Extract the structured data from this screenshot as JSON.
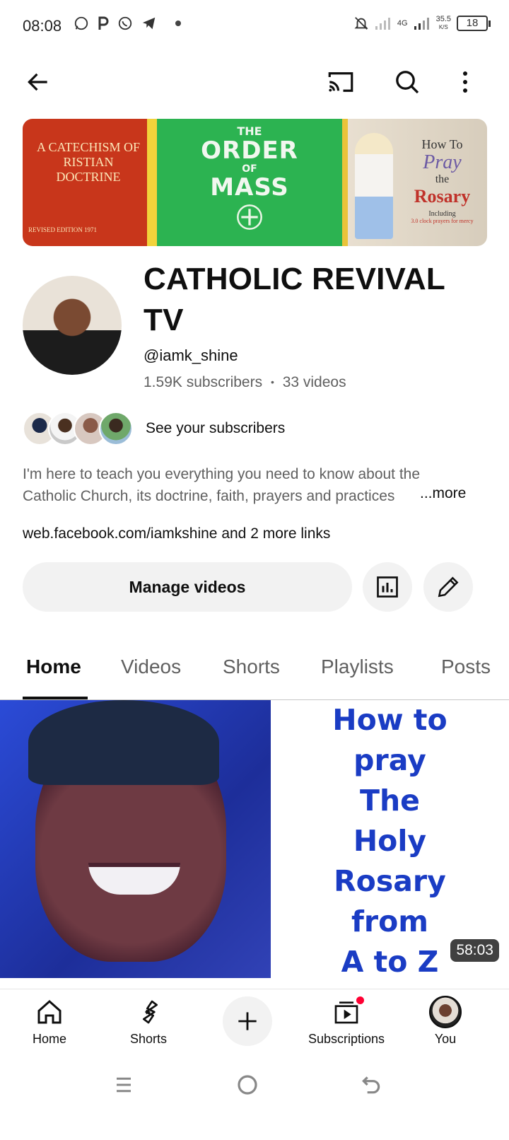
{
  "status_bar": {
    "time": "08:08",
    "network": "4G",
    "speed_value": "35.5",
    "speed_unit": "K/S",
    "battery": "18"
  },
  "banner": {
    "book1_title": "A CATECHISM OF RISTIAN DOCTRINE",
    "book1_edition": "REVISED EDITION 1971",
    "book2_line1": "THE",
    "book2_line2": "ORDER",
    "book2_line3": "OF",
    "book2_line4": "MASS",
    "book3_line1": "How To",
    "book3_line2": "Pray",
    "book3_line3": "the",
    "book3_line4": "Rosary",
    "book3_line5": "Including",
    "book3_line6": "3.0 clock prayers for mercy"
  },
  "channel": {
    "title": "CATHOLIC REVIVAL TV",
    "handle": "@iamk_shine",
    "subscribers": "1.59K subscribers",
    "separator": "•",
    "videos": "33 videos",
    "see_subscribers": "See your subscribers",
    "description": "I'm here to teach you everything you need to know about the Catholic Church, its doctrine, faith, prayers and practices",
    "more": "...more",
    "link": "web.facebook.com/iamkshine",
    "more_links": "and 2 more links",
    "manage_videos": "Manage videos"
  },
  "tabs": [
    "Home",
    "Videos",
    "Shorts",
    "Playlists",
    "Posts"
  ],
  "video": {
    "thumb_text_lines": [
      "How to",
      "pray",
      "The",
      "Holy",
      "Rosary",
      "from",
      "A to Z"
    ],
    "duration": "58:03"
  },
  "bottom_nav": {
    "home": "Home",
    "shorts": "Shorts",
    "subscriptions": "Subscriptions",
    "you": "You"
  },
  "colors": {
    "accent_red": "#ff0033",
    "text_primary": "#0f0f0f",
    "text_secondary": "#606060",
    "button_bg": "#f2f2f2",
    "thumb_text_blue": "#1a3cc4"
  }
}
